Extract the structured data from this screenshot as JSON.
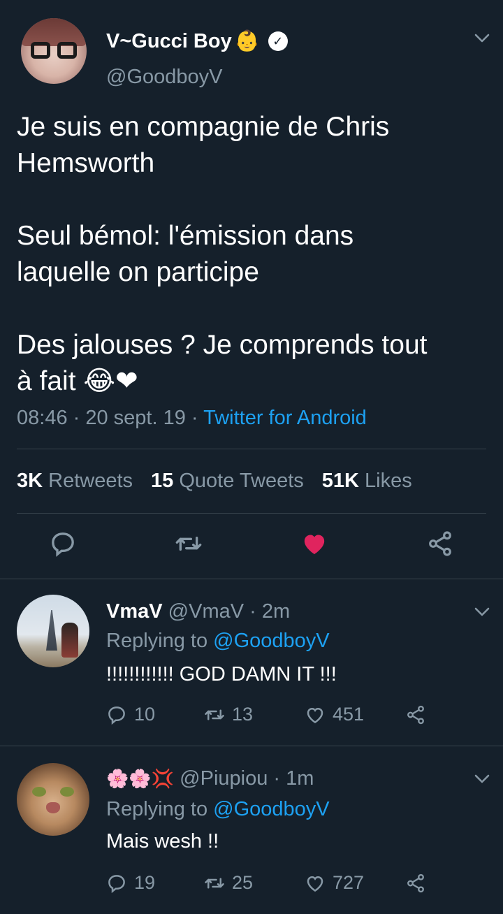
{
  "main_tweet": {
    "display_name": "V~Gucci Boy",
    "name_emoji": "👶",
    "verified_mark": "✓",
    "handle": "@GoodboyV",
    "text_lines": [
      "Je suis en compagnie de Chris",
      "Hemsworth",
      "Seul bémol: l'émission dans",
      "laquelle on participe",
      "Des jalouses ? Je comprends tout",
      "à fait 😂❤"
    ],
    "time": "08:46 · 20 sept. 19 · ",
    "source": "Twitter for Android",
    "stats": {
      "retweets_count": "3K",
      "retweets_label": "Retweets",
      "quotes_count": "15",
      "quotes_label": "Quote Tweets",
      "likes_count": "51K",
      "likes_label": "Likes"
    },
    "actions": [
      "reply-icon",
      "retweet-icon",
      "like-icon-filled",
      "share-icon"
    ],
    "like_color": "#e0245e"
  },
  "replies": [
    {
      "name": "VmaV",
      "handle_time": " @VmaV · 2m",
      "replying_label": "Replying to ",
      "replying_to": "@GoodboyV",
      "text": "!!!!!!!!!!!! GOD DAMN IT !!!",
      "reply_count": "10",
      "retweet_count": "13",
      "like_count": "451"
    },
    {
      "name": "🌸🌸💢",
      "handle_time": " @Piupiou · 1m",
      "replying_label": "Replying to ",
      "replying_to": "@GoodboyV",
      "text": "Mais wesh !!",
      "reply_count": "19",
      "retweet_count": "25",
      "like_count": "727"
    }
  ],
  "colors": {
    "background": "#15202b",
    "muted": "#8899a6",
    "link": "#1da1f2",
    "divider": "#38444d"
  }
}
